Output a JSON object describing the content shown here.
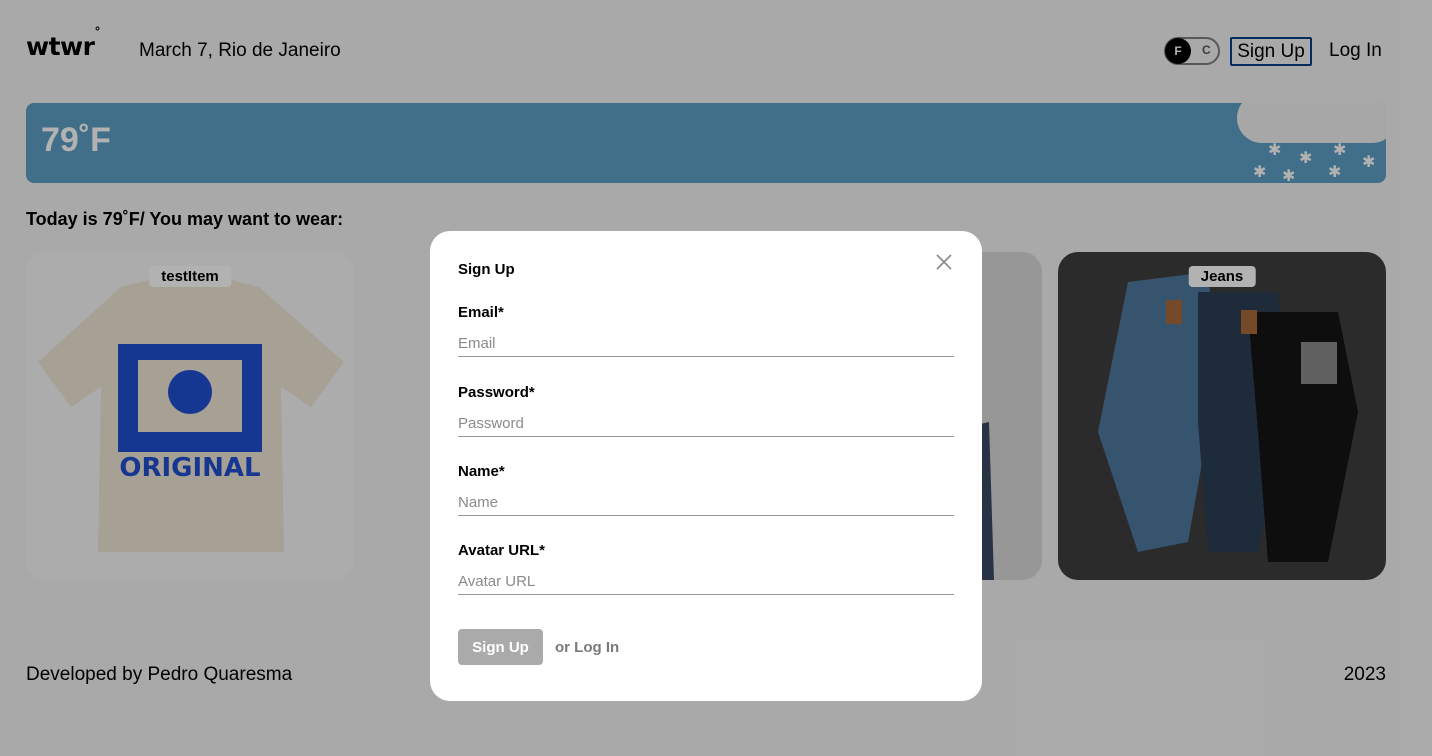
{
  "header": {
    "logo": "wtwr",
    "logo_mark": "°",
    "date_location": "March 7, Rio de Janeiro",
    "toggle": {
      "selected": "F",
      "other": "C"
    },
    "signup_label": "Sign Up",
    "login_label": "Log In"
  },
  "weather": {
    "temperature": "79˚F",
    "condition_icon": "snow-cloud-icon",
    "background_color": "#5e9fc6"
  },
  "main": {
    "today_text": "Today is 79˚F/ You may want to wear:"
  },
  "cards": [
    {
      "name": "testItem",
      "image_icon": "t-shirt-image"
    },
    {
      "name": "",
      "image_icon": "clothing-image"
    },
    {
      "name": "Jeans",
      "image_icon": "jeans-image"
    }
  ],
  "footer": {
    "developer": "Developed by Pedro Quaresma",
    "year": "2023"
  },
  "modal": {
    "title": "Sign Up",
    "close_icon": "close-icon",
    "fields": [
      {
        "label": "Email*",
        "placeholder": "Email",
        "value": ""
      },
      {
        "label": "Password*",
        "placeholder": "Password",
        "value": ""
      },
      {
        "label": "Name*",
        "placeholder": "Name",
        "value": ""
      },
      {
        "label": "Avatar URL*",
        "placeholder": "Avatar URL",
        "value": ""
      }
    ],
    "submit_label": "Sign Up",
    "alt_link": "or Log In",
    "submit_color": "#aaaaaa"
  }
}
